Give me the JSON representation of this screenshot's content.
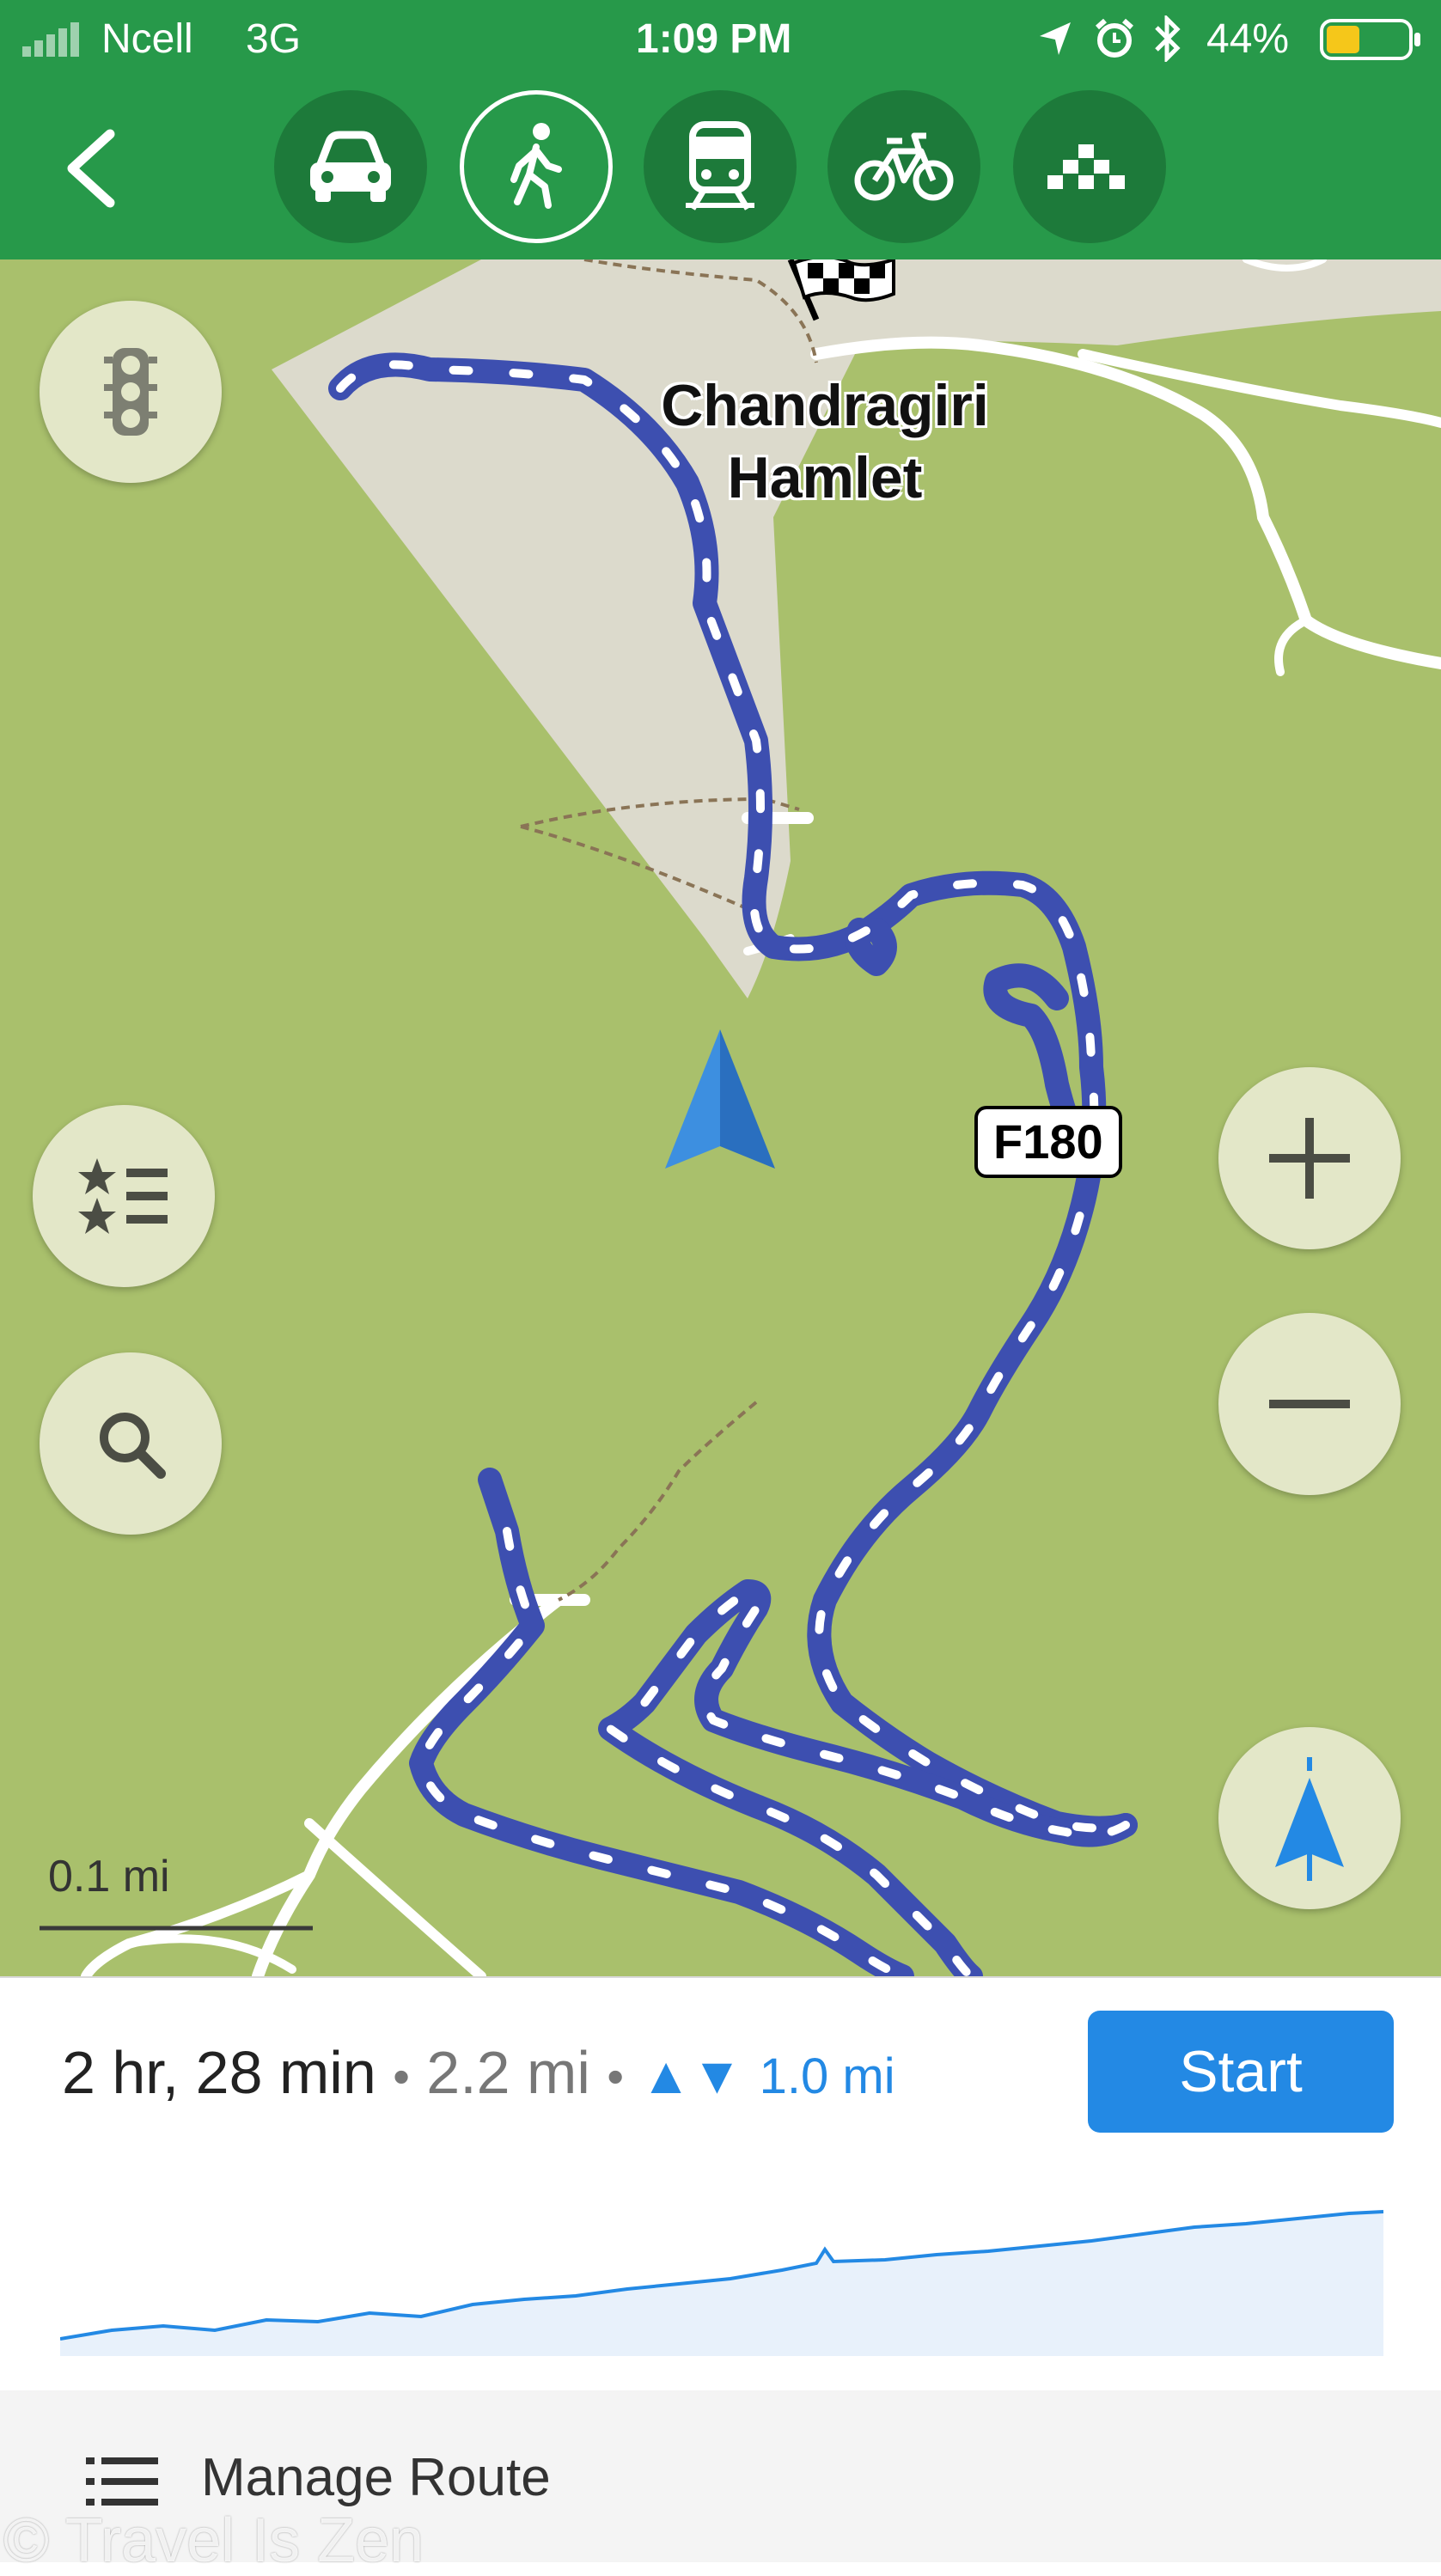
{
  "status_bar": {
    "carrier": "Ncell",
    "network": "3G",
    "time": "1:09 PM",
    "battery": "44%"
  },
  "header": {
    "back_icon": "chevron-left-icon",
    "modes": [
      {
        "name": "car",
        "icon": "car-icon",
        "active": false
      },
      {
        "name": "walk",
        "icon": "walking-person-icon",
        "active": true
      },
      {
        "name": "transit",
        "icon": "train-icon",
        "active": false
      },
      {
        "name": "bike",
        "icon": "bicycle-icon",
        "active": false
      },
      {
        "name": "taxi",
        "icon": "taxi-checker-icon",
        "active": false
      }
    ]
  },
  "map": {
    "place_label_line1": "Chandragiri",
    "place_label_line2": "Hamlet",
    "road_label": "F180",
    "scale_label": "0.1 mi",
    "colors": {
      "land": "#a9c06c",
      "route": "#3d4fb0",
      "accent": "#2389e4"
    }
  },
  "summary": {
    "duration": "2 hr, 28 min",
    "separator": "•",
    "distance": "2.2 mi",
    "elevation": "1.0 mi",
    "start_label": "Start"
  },
  "footer": {
    "manage_label": "Manage Route",
    "watermark": "© Travel Is Zen"
  }
}
